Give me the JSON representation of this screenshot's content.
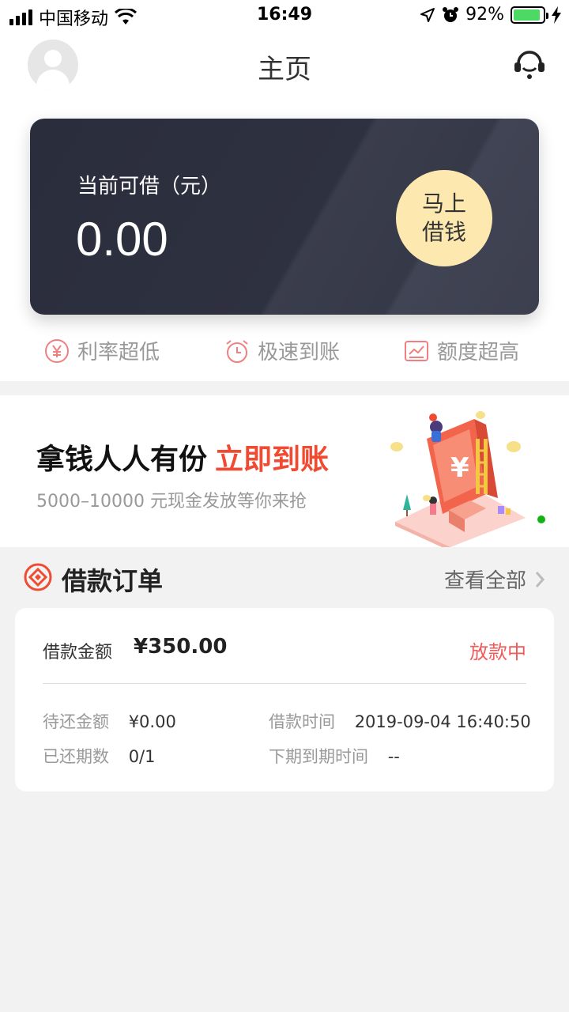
{
  "status_bar": {
    "carrier": "中国移动",
    "time": "16:49",
    "battery_percent": "92%",
    "battery_level": 0.92
  },
  "header": {
    "title": "主页",
    "avatar_icon": "user-avatar-icon",
    "service_icon": "customer-service-icon"
  },
  "loan_card": {
    "label": "当前可借（元）",
    "amount": "0.00",
    "button_line1": "马上",
    "button_line2": "借钱"
  },
  "features": [
    {
      "label": "利率超低",
      "icon": "yen-circle-icon"
    },
    {
      "label": "极速到账",
      "icon": "alarm-clock-icon"
    },
    {
      "label": "额度超高",
      "icon": "chart-trend-icon"
    }
  ],
  "banner": {
    "title": "拿钱人人有份",
    "title_accent": "立即到账",
    "subtitle": "5000–10000 元现金发放等你来抢"
  },
  "orders": {
    "title": "借款订单",
    "view_all": "查看全部",
    "order": {
      "amount_label": "借款金额",
      "amount": "¥350.00",
      "status": "放款中",
      "pending_label": "待还金额",
      "pending_value": "¥0.00",
      "time_label": "借款时间",
      "time_value": "2019-09-04 16:40:50",
      "periods_label": "已还期数",
      "periods_value": "0/1",
      "due_label": "下期到期时间",
      "due_value": "--"
    }
  },
  "colors": {
    "accent_red": "#f04b32",
    "status_red": "#f05a5a",
    "button_yellow": "#fde9b0",
    "card_dark": "#2a2d3b"
  }
}
